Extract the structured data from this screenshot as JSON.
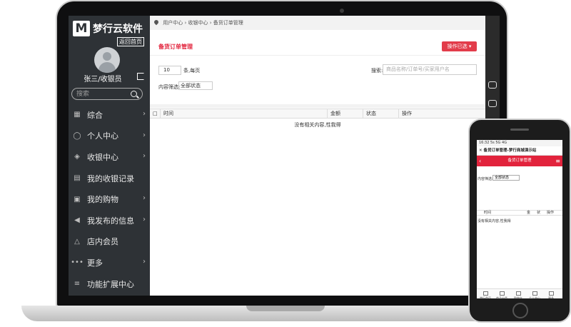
{
  "brand": {
    "logo_letter": "M",
    "name": "梦行云软件",
    "back_home": "返回首页"
  },
  "user": {
    "name": "张三/收银员"
  },
  "sidebar": {
    "search_placeholder": "搜索",
    "items": [
      {
        "label": "综合",
        "icon": "grid-icon",
        "has_arrow": true
      },
      {
        "label": "个人中心",
        "icon": "user-icon",
        "has_arrow": true
      },
      {
        "label": "收银中心",
        "icon": "cashier-icon",
        "has_arrow": true
      },
      {
        "label": "我的收银记录",
        "icon": "record-icon",
        "has_arrow": false
      },
      {
        "label": "我的购物",
        "icon": "cart-icon",
        "has_arrow": true
      },
      {
        "label": "我发布的信息",
        "icon": "megaphone-icon",
        "has_arrow": true
      },
      {
        "label": "店内会员",
        "icon": "member-icon",
        "has_arrow": false
      },
      {
        "label": "更多",
        "icon": "more-dots-icon",
        "has_arrow": true
      },
      {
        "label": "功能扩展中心",
        "icon": "menu-lines-icon",
        "has_arrow": false
      }
    ]
  },
  "breadcrumb": "用户中心 › 收银中心 › 备货订单管理",
  "panel": {
    "title": "备货订单管理",
    "op_button": "操作已选 ▾"
  },
  "table": {
    "length_value": "10",
    "length_label": "条,每页",
    "search_label": "搜索:",
    "search_placeholder": "商品名称/订单号/买家用户名",
    "filter_label": "内容筛选:",
    "filter_value": "全部状态",
    "columns": [
      "时间",
      "金额",
      "状态",
      "操作"
    ],
    "empty_text": "没有相关内容,性我得"
  },
  "phone": {
    "status": "16:32  5s  5G  4G",
    "title": "备货订单管理-梦行商城演示站",
    "header": "备货订单管理",
    "filter_label": "内容筛选:",
    "filter_value": "全部状态",
    "columns": [
      "时间",
      "金",
      "状",
      "操作"
    ],
    "empty_text": "没有相关内容,性我得",
    "tabs": [
      "梦行首页",
      "商品分类",
      "购物车",
      "个人中心",
      "更多"
    ]
  },
  "colors": {
    "accent": "#e2233c",
    "sidebar": "#2e3236"
  }
}
